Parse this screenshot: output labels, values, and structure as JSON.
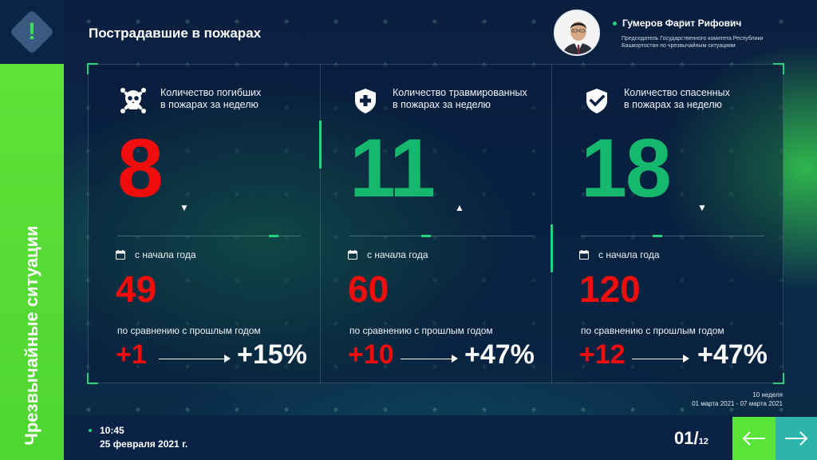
{
  "sidebar": {
    "title": "Чрезвычайные ситуации"
  },
  "header": {
    "title": "Пострадавшие в пожарах",
    "person": {
      "name": "Гумеров Фарит Рифович",
      "role": "Председатель Государственного комитета Республики Башкортостан по чрезвычайным ситуациям"
    }
  },
  "cards": [
    {
      "icon": "skull-icon",
      "label_line1": "Количество погибших",
      "label_line2": "в пожарах за неделю",
      "value": "8",
      "value_color": "#f20d0d",
      "trend": "▼",
      "ytd_label": "с начала года",
      "ytd_value": "49",
      "compare_label": "по сравнению с прошлым годом",
      "delta_abs": "+1",
      "delta_pct": "+15%"
    },
    {
      "icon": "shield-plus-icon",
      "label_line1": "Количество травмированных",
      "label_line2": "в пожарах за неделю",
      "value": "11",
      "value_color": "#16b86e",
      "trend": "▲",
      "ytd_label": "с начала года",
      "ytd_value": "60",
      "compare_label": "по сравнению с прошлым годом",
      "delta_abs": "+10",
      "delta_pct": "+47%"
    },
    {
      "icon": "shield-check-icon",
      "label_line1": "Количество спасенных",
      "label_line2": "в пожарах за неделю",
      "value": "18",
      "value_color": "#16b86e",
      "trend": "▼",
      "ytd_label": "с начала года",
      "ytd_value": "120",
      "compare_label": "по сравнению с прошлым годом",
      "delta_abs": "+12",
      "delta_pct": "+47%"
    }
  ],
  "week": {
    "number": "10 неделя",
    "range": "01 марта 2021 - 07 марта 2021"
  },
  "footer": {
    "time": "10:45",
    "date": "25 февраля 2021 г.",
    "page_current": "01",
    "page_separator": "/",
    "page_total": "12"
  },
  "colors": {
    "accent_green": "#26d07c",
    "alert_red": "#f20d0d",
    "rail_green": "#5ee23a",
    "nav_teal": "#2fb4ab"
  }
}
